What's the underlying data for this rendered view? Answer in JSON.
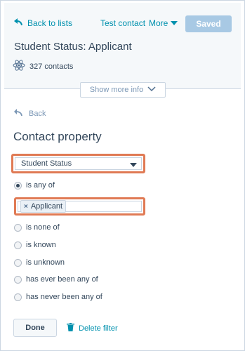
{
  "header": {
    "back_label": "Back to lists",
    "test_contact_label": "Test contact",
    "more_label": "More",
    "saved_label": "Saved",
    "list_title": "Student Status: Applicant",
    "contacts_count": "327 contacts",
    "show_more_label": "Show more info"
  },
  "filter": {
    "back_label": "Back",
    "section_title": "Contact property",
    "property_select": "Student Status",
    "options": [
      {
        "label": "is any of",
        "selected": true
      },
      {
        "label": "is none of",
        "selected": false
      },
      {
        "label": "is known",
        "selected": false
      },
      {
        "label": "is unknown",
        "selected": false
      },
      {
        "label": "has ever been any of",
        "selected": false
      },
      {
        "label": "has never been any of",
        "selected": false
      }
    ],
    "tag_value": "Applicant",
    "done_label": "Done",
    "delete_label": "Delete filter"
  },
  "colors": {
    "accent": "#0091ae",
    "highlight": "#e07a54",
    "saved_button": "#a8c9e4"
  }
}
